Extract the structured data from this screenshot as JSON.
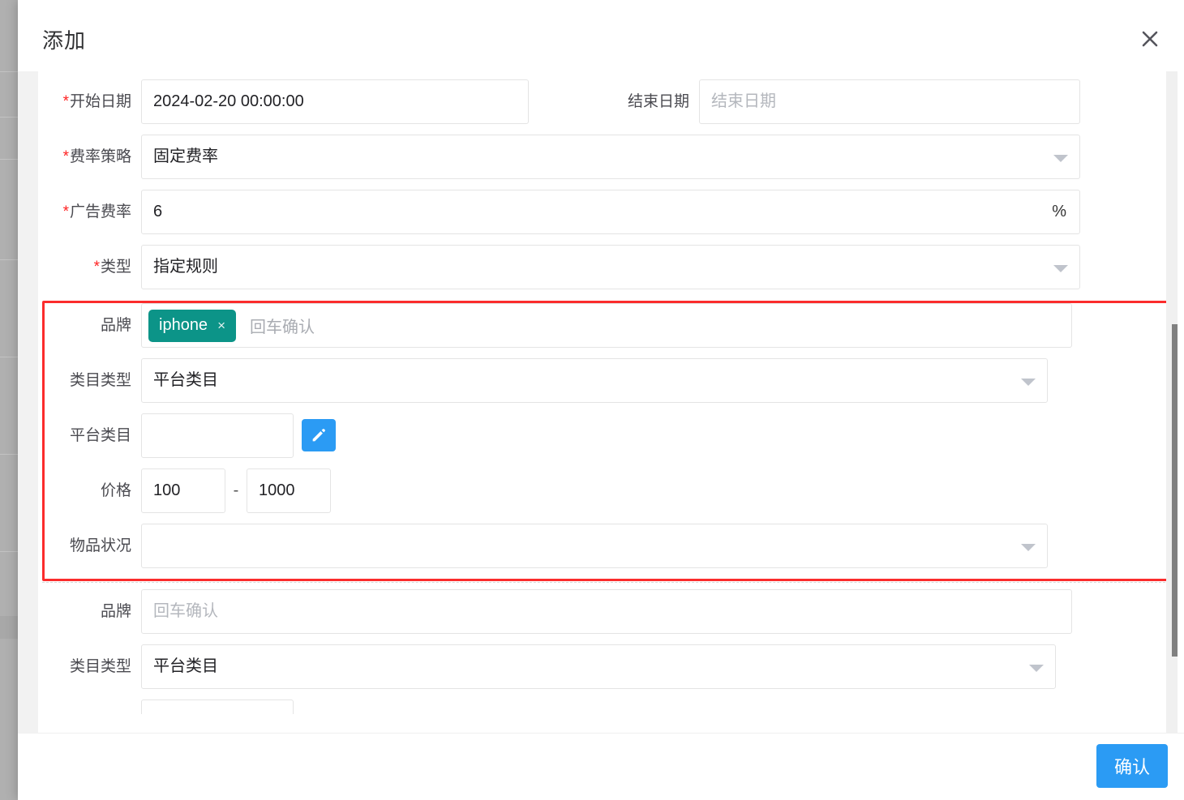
{
  "dialog": {
    "title": "添加",
    "close_icon": "close-icon",
    "confirm_label": "确认"
  },
  "form": {
    "date_row": {
      "start_label": "开始日期",
      "start_required": "*",
      "start_value": "2024-02-20 00:00:00",
      "end_label": "结束日期",
      "end_placeholder": "结束日期"
    },
    "rate_policy": {
      "label": "费率策略",
      "required": "*",
      "value": "固定费率"
    },
    "ad_rate": {
      "label": "广告费率",
      "required": "*",
      "value": "6",
      "suffix": "%"
    },
    "type": {
      "label": "类型",
      "required": "*",
      "value": "指定规则"
    }
  },
  "rule_block_1": {
    "brand": {
      "label": "品牌",
      "tags": [
        "iphone"
      ],
      "tag_remove_icon": "×",
      "placeholder": "回车确认"
    },
    "category_type": {
      "label": "类目类型",
      "value": "平台类目"
    },
    "platform_category": {
      "label": "平台类目",
      "value": "",
      "edit_icon": "pencil-icon"
    },
    "price": {
      "label": "价格",
      "min": "100",
      "separator": "-",
      "max": "1000"
    },
    "condition": {
      "label": "物品状况",
      "value": ""
    }
  },
  "rule_block_2": {
    "brand": {
      "label": "品牌",
      "placeholder": "回车确认"
    },
    "category_type": {
      "label": "类目类型",
      "value": "平台类目"
    }
  },
  "colors": {
    "accent_blue": "#2b9bf4",
    "tag_teal": "#0c9488",
    "highlight_red": "#fb2c2c"
  }
}
